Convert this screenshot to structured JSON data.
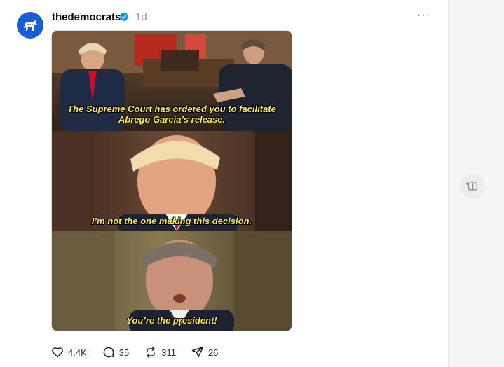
{
  "post": {
    "username": "thedemocrats",
    "timestamp": "1d",
    "more_label": "···",
    "captions": [
      "The Supreme Court has ordered you to facilitate Abrego Garcia’s release.",
      "I’m not the one making this decision.",
      "You’re the president!"
    ],
    "stats": {
      "likes": "4.4K",
      "replies": "35",
      "reposts": "311",
      "shares": "26"
    }
  },
  "icons": {
    "avatar": "donkey-logo-icon",
    "verified": "verified-badge-icon",
    "like": "heart-icon",
    "reply": "comment-icon",
    "repost": "repost-icon",
    "share": "send-icon",
    "side": "columns-add-icon"
  },
  "colors": {
    "accent": "#1a5bd6",
    "caption": "#ffee33",
    "timestamp": "#999999"
  }
}
